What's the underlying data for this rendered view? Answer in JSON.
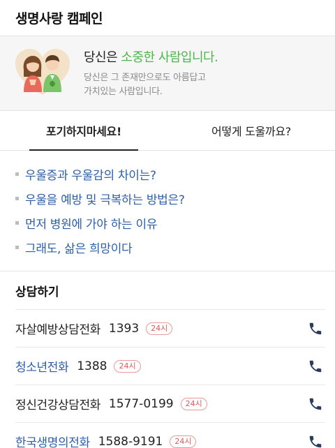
{
  "header": {
    "title": "생명사랑 캠페인"
  },
  "banner": {
    "title_prefix": "당신은 ",
    "title_highlight": "소중한 사람입니다.",
    "sub_line1": "당신은 그 존재만으로도 아름답고",
    "sub_line2": "가치있는 사람입니다."
  },
  "tabs": [
    {
      "label": "포기하지마세요!"
    },
    {
      "label": "어떻게 도울까요?"
    }
  ],
  "links": [
    {
      "label": "우울증과 우울감의 차이는?"
    },
    {
      "label": "우울을 예방 및 극복하는 방법은?"
    },
    {
      "label": "먼저 병원에 가야 하는 이유"
    },
    {
      "label": "그래도, 삶은 희망이다"
    }
  ],
  "consult": {
    "title": "상담하기",
    "rows": [
      {
        "name": "자살예방상담전화",
        "number": "1393",
        "badge": "24시"
      },
      {
        "name": "청소년전화",
        "number": "1388",
        "badge": "24시"
      },
      {
        "name": "정신건강상담전화",
        "number": "1577-0199",
        "badge": "24시"
      },
      {
        "name": "한국생명의전화",
        "number": "1588-9191",
        "badge": "24시"
      }
    ]
  },
  "colors": {
    "accent_green": "#4cb64b",
    "link_blue": "#2d5fa9",
    "badge_red": "#e05a5a",
    "phone_navy": "#2b3b5c"
  },
  "icons": {
    "phone": "phone-icon",
    "illustration": "couple-illustration"
  }
}
